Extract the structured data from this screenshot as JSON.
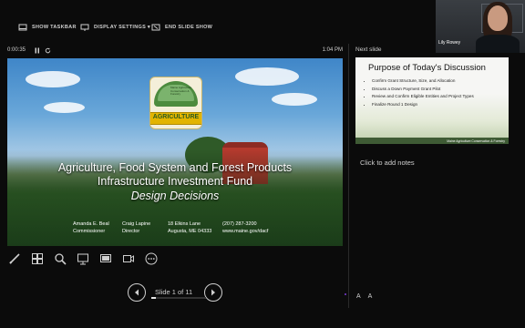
{
  "toolbar": {
    "show_taskbar": "SHOW TASKBAR",
    "display_settings": "DISPLAY SETTINGS ▾",
    "end_slide_show": "END SLIDE SHOW"
  },
  "webcam": {
    "name": "Lily Rowey"
  },
  "timer": {
    "elapsed": "0:00:35",
    "pause_icon": "pause-icon",
    "restart_icon": "restart-icon",
    "clock": "1:04 PM"
  },
  "next_slide": {
    "label": "Next slide",
    "title": "Purpose of Today's Discussion",
    "bullets": [
      "Confirm Grant Structure, Size, and Allocation",
      "Discuss a Down Payment Grant Pilot",
      "Review and Confirm Eligible Entities and Project Types",
      "Finalize Round 1 Design"
    ],
    "footer": "Maine Agriculture Conservation & Forestry"
  },
  "current_slide": {
    "logo": {
      "seal_text": "Maine Agriculture Conservation & Forestry",
      "band": "AGRICULTURE"
    },
    "title_line1": "Agriculture, Food System and Forest Products",
    "title_line2": "Infrastructure Investment Fund",
    "subtitle": "Design Decisions",
    "contact": {
      "name": "Amanda E. Beal",
      "name_role": "Commissioner",
      "deputy": "Craig Lapine",
      "deputy_role": "Director",
      "address1": "18 Elkins Lane",
      "address2": "Augusta, ME 04333",
      "phone": "(207) 287-3200",
      "web": "www.maine.gov/dacf"
    }
  },
  "notes": {
    "placeholder": "Click to add notes"
  },
  "tools": [
    "pen-icon",
    "slides-grid-icon",
    "zoom-icon",
    "pointer-icon",
    "black-screen-icon",
    "camera-icon",
    "more-icon"
  ],
  "pager": {
    "label": "Slide 1 of 11",
    "progress": 0.09
  },
  "font_buttons": {
    "increase": "A",
    "decrease": "A"
  },
  "colors": {
    "background": "#0b0b0b",
    "slide_green": "#2f6d2c",
    "logo_band": "#e2b400"
  }
}
